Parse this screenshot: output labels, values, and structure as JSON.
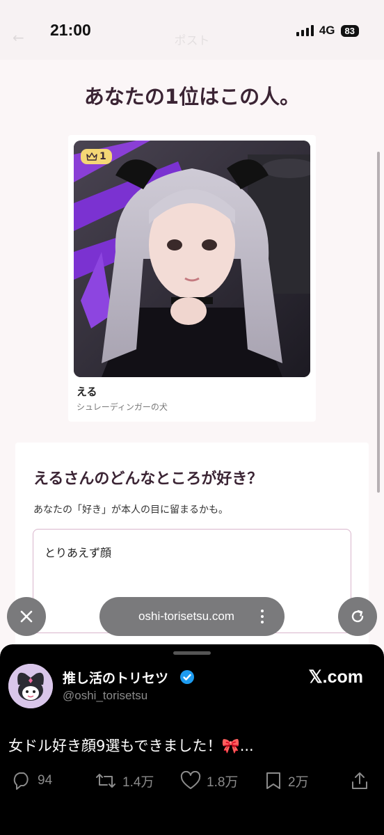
{
  "status": {
    "time": "21:00",
    "network": "4G",
    "battery": "83"
  },
  "header": {
    "ghost_title": "ポスト",
    "ghost_back": "←"
  },
  "page": {
    "title": "あなたの1位はこの人。"
  },
  "card": {
    "rank": "1",
    "name": "える",
    "group": "シュレーディンガーの犬"
  },
  "question": {
    "title": "えるさんのどんなところが好き？",
    "subtitle": "あなたの「好き」が本人の目に留まるかも。",
    "answer": "とりあえず顔"
  },
  "browser": {
    "url": "oshi-torisetsu.com"
  },
  "tweet": {
    "display_name": "推し活のトリセツ",
    "handle": "@oshi_torisetsu",
    "source": "𝕏.com",
    "text": "女ドル好き顔9選もできました！",
    "emoji": "🎀",
    "ellipsis": "...",
    "replies": "94",
    "retweets": "1.4万",
    "likes": "1.8万",
    "bookmarks": "2万"
  },
  "colors": {
    "accent": "#3b2434",
    "badge": "#f4d775",
    "field_border": "#d9b5cc",
    "verified": "#1d9bf0"
  },
  "icons": [
    "crown-icon",
    "close-icon",
    "reload-icon",
    "more-icon",
    "verified-icon",
    "reply-icon",
    "retweet-icon",
    "like-icon",
    "bookmark-icon",
    "share-icon"
  ]
}
